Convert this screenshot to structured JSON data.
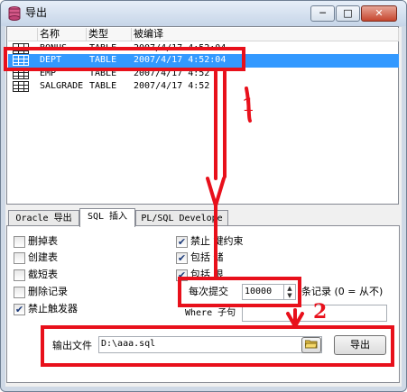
{
  "window": {
    "title": "导出"
  },
  "list": {
    "columns": [
      "名称",
      "类型",
      "被编译"
    ],
    "rows": [
      {
        "name": "BONUS",
        "type": "TABLE",
        "compiled": "2007/4/17 4:52:04"
      },
      {
        "name": "DEPT",
        "type": "TABLE",
        "compiled": "2007/4/17 4:52:04"
      },
      {
        "name": "EMP",
        "type": "TABLE",
        "compiled": "2007/4/17 4:52"
      },
      {
        "name": "SALGRADE",
        "type": "TABLE",
        "compiled": "2007/4/17 4:52"
      }
    ]
  },
  "tabs": [
    "Oracle 导出",
    "SQL 插入",
    "PL/SQL Develope"
  ],
  "options_left": [
    {
      "label": "删掉表",
      "checked": false
    },
    {
      "label": "创建表",
      "checked": false
    },
    {
      "label": "截短表",
      "checked": false
    },
    {
      "label": "删除记录",
      "checked": false
    },
    {
      "label": "禁止触发器",
      "checked": true
    }
  ],
  "options_right": [
    {
      "label": "禁止   键约束",
      "checked": true
    },
    {
      "label": "包括   储",
      "checked": true
    },
    {
      "label": "包括   限",
      "checked": true
    }
  ],
  "commit": {
    "label": "每次提交",
    "value": "10000",
    "suffix": "条记录 (0 = 从不)"
  },
  "where": {
    "label": "Where 子句",
    "value": ""
  },
  "output": {
    "label": "输出文件",
    "value": "D:\\aaa.sql",
    "export_button": "导出"
  },
  "annotations": [
    "1",
    "2"
  ]
}
